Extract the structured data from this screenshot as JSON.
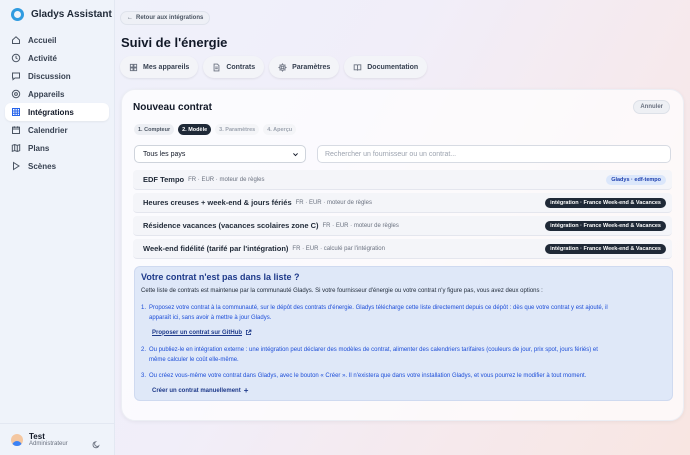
{
  "app": {
    "name": "Gladys Assistant"
  },
  "sidebar": {
    "items": [
      {
        "label": "Accueil",
        "icon": "home-icon"
      },
      {
        "label": "Activité",
        "icon": "clock-icon"
      },
      {
        "label": "Discussion",
        "icon": "chat-icon"
      },
      {
        "label": "Appareils",
        "icon": "wifi-icon"
      },
      {
        "label": "Intégrations",
        "icon": "grid-icon",
        "active": true
      },
      {
        "label": "Calendrier",
        "icon": "calendar-icon"
      },
      {
        "label": "Plans",
        "icon": "map-icon"
      },
      {
        "label": "Scènes",
        "icon": "play-icon"
      }
    ],
    "user": {
      "name": "Test",
      "role": "Administrateur"
    }
  },
  "header": {
    "back_label": "Retour aux intégrations",
    "title": "Suivi de l'énergie",
    "tabs": [
      {
        "label": "Mes appareils",
        "icon": "devices-icon"
      },
      {
        "label": "Contrats",
        "icon": "document-icon"
      },
      {
        "label": "Paramètres",
        "icon": "settings-icon"
      },
      {
        "label": "Documentation",
        "icon": "book-icon"
      }
    ]
  },
  "card": {
    "title": "Nouveau contrat",
    "cancel_label": "Annuler",
    "steps": [
      {
        "label": "1. Compteur",
        "state": "done"
      },
      {
        "label": "2. Modèle",
        "state": "active"
      },
      {
        "label": "3. Paramètres",
        "state": "todo"
      },
      {
        "label": "4. Aperçu",
        "state": "todo"
      }
    ],
    "country_select": {
      "value": "Tous les pays"
    },
    "search": {
      "placeholder": "Rechercher un fournisseur ou un contrat..."
    },
    "contracts": [
      {
        "name": "EDF Tempo",
        "meta": "FR · EUR · moteur de règles",
        "badge": "Gladys · edf-tempo",
        "badge_style": "blue"
      },
      {
        "name": "Heures creuses + week-end & jours fériés",
        "meta": "FR · EUR · moteur de règles",
        "badge": "intégration · France Week-end & Vacances",
        "badge_style": "dark"
      },
      {
        "name": "Résidence vacances (vacances scolaires zone C)",
        "meta": "FR · EUR · moteur de règles",
        "badge": "intégration · France Week-end & Vacances",
        "badge_style": "dark"
      },
      {
        "name": "Week-end fidélité (tarifé par l'intégration)",
        "meta": "FR · EUR · calculé par l'intégration",
        "badge": "intégration · France Week-end & Vacances",
        "badge_style": "dark"
      }
    ],
    "info": {
      "title": "Votre contrat n'est pas dans la liste ?",
      "intro": "Cette liste de contrats est maintenue par la communauté Gladys. Si votre fournisseur d'énergie ou votre contrat n'y figure pas, vous avez deux options :",
      "options": [
        {
          "num": "1.",
          "line1": "Proposez votre contrat à la communauté, sur le dépôt des contrats d'énergie. Gladys télécharge cette liste directement depuis ce dépôt : dès que votre contrat y est ajouté, il",
          "line2": "apparaît ici, sans avoir à mettre à jour Gladys."
        },
        {
          "num": "2.",
          "line1": "Ou publiez-le en intégration externe : une intégration peut déclarer des modèles de contrat, alimenter des calendriers tarifaires (couleurs de jour, prix spot, jours fériés) et",
          "line2": "même calculer le coût elle-même."
        },
        {
          "num": "3.",
          "line1": "Ou créez vous-même votre contrat dans Gladys, avec le bouton « Créer ». Il n'existera que dans votre installation Gladys, et vous pourrez le modifier à tout moment.",
          "line2": ""
        }
      ],
      "github_link": "Proposer un contrat sur GitHub",
      "create_link": "Créer un contrat manuellement"
    }
  }
}
